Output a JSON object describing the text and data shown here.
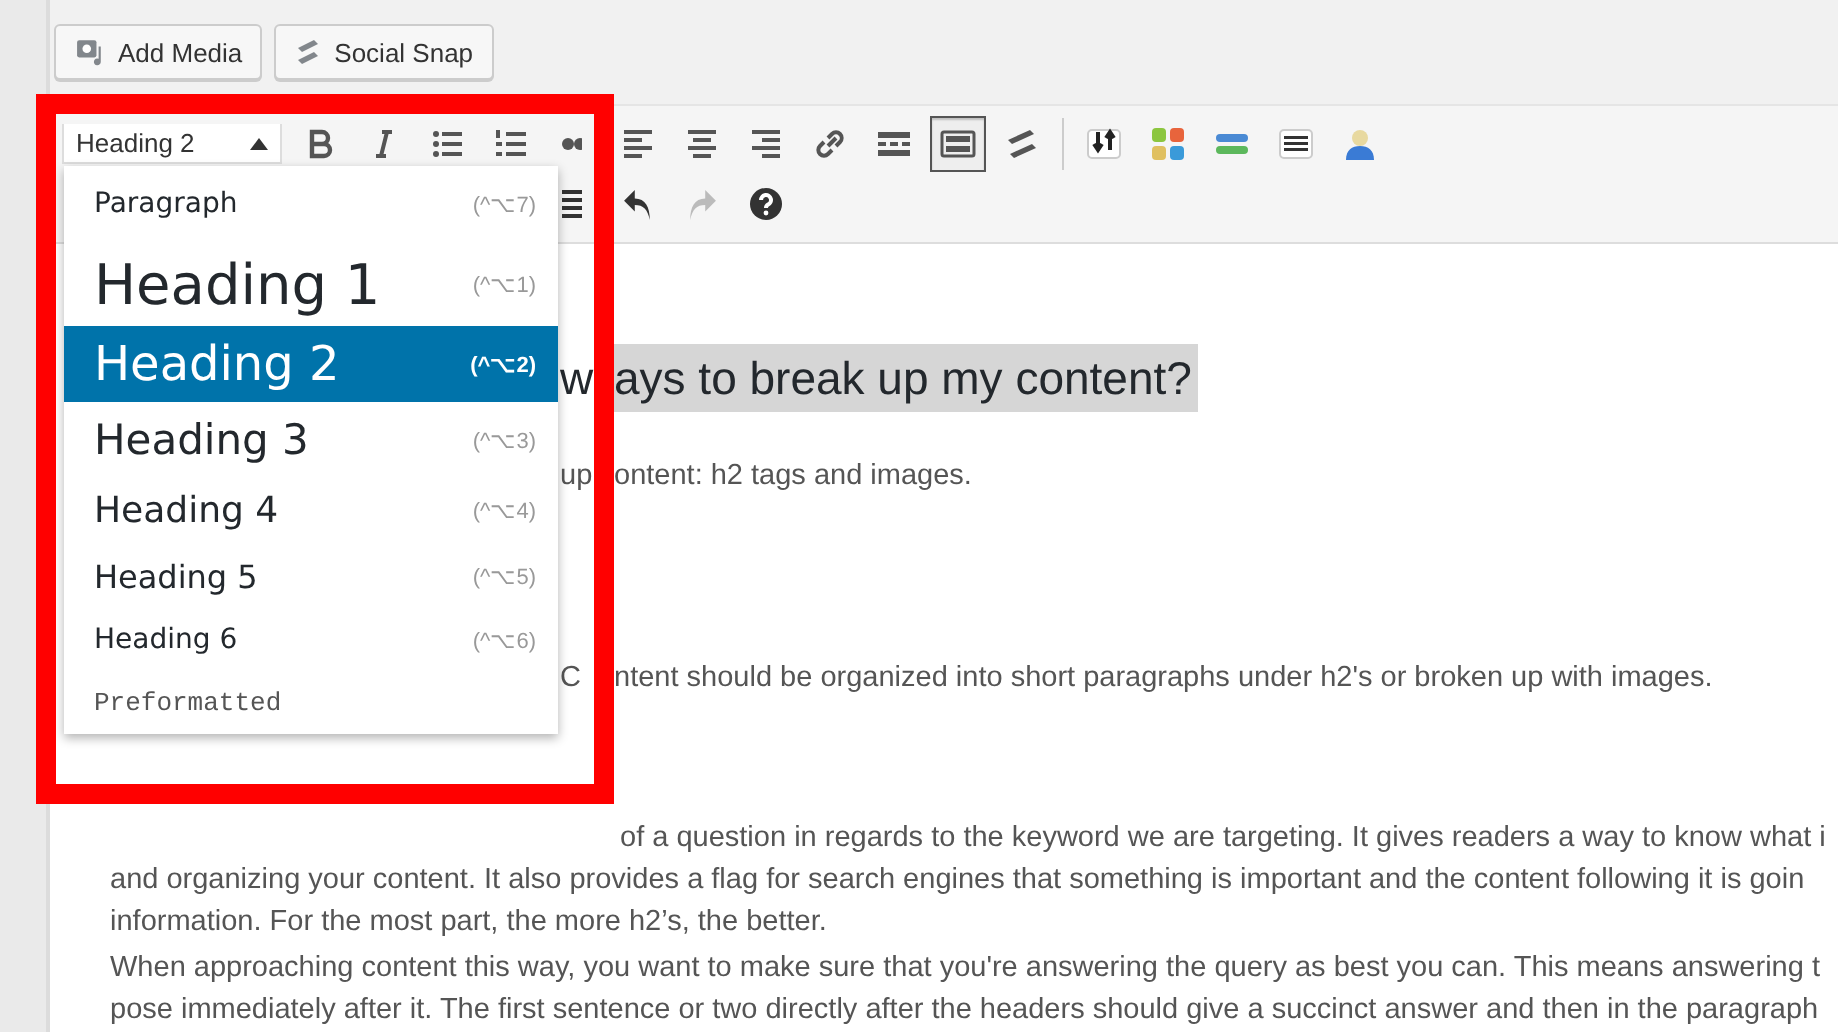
{
  "media_buttons": [
    {
      "kind": "media",
      "label": "Add Media"
    },
    {
      "kind": "snap",
      "label": "Social Snap"
    }
  ],
  "toolbar": {
    "format_select": {
      "value": "Heading 2",
      "expanded": true
    },
    "row1": [
      {
        "kind": "bold",
        "active": false
      },
      {
        "kind": "italic",
        "active": false
      },
      {
        "kind": "bullets",
        "active": false
      },
      {
        "kind": "numbers",
        "active": false
      },
      {
        "kind": "quote",
        "active": false
      },
      {
        "kind": "align-left",
        "active": false
      },
      {
        "kind": "align-center",
        "active": false
      },
      {
        "kind": "align-right",
        "active": false
      },
      {
        "kind": "link",
        "active": false
      },
      {
        "kind": "more",
        "active": false
      },
      {
        "kind": "toggle",
        "active": true
      },
      {
        "kind": "snap",
        "active": false
      },
      {
        "kind": "sort",
        "active": false
      },
      {
        "kind": "blocks",
        "active": false
      },
      {
        "kind": "bars",
        "active": false
      },
      {
        "kind": "list",
        "active": false
      },
      {
        "kind": "person",
        "active": false
      }
    ],
    "row2": [
      {
        "kind": "text-color",
        "disabled": false
      },
      {
        "kind": "undo",
        "disabled": false
      },
      {
        "kind": "redo",
        "disabled": true
      },
      {
        "kind": "help",
        "disabled": false
      }
    ]
  },
  "format_menu": [
    {
      "kind": "paragraph",
      "label": "Paragraph",
      "shortcut": "(^⌥7)",
      "selected": false
    },
    {
      "kind": "h1",
      "label": "Heading 1",
      "shortcut": "(^⌥1)",
      "selected": false
    },
    {
      "kind": "h2",
      "label": "Heading 2",
      "shortcut": "(^⌥2)",
      "selected": true
    },
    {
      "kind": "h3",
      "label": "Heading 3",
      "shortcut": "(^⌥3)",
      "selected": false
    },
    {
      "kind": "h4",
      "label": "Heading 4",
      "shortcut": "(^⌥4)",
      "selected": false
    },
    {
      "kind": "h5",
      "label": "Heading 5",
      "shortcut": "(^⌥5)",
      "selected": false
    },
    {
      "kind": "h6",
      "label": "Heading 6",
      "shortcut": "(^⌥6)",
      "selected": false
    },
    {
      "kind": "pre",
      "label": "Preformatted",
      "selected": false
    }
  ],
  "content": [
    {
      "kind": "heading",
      "lines": [
        {
          "kind": "split",
          "before": "w",
          "text": "ays to break up my content?"
        }
      ]
    },
    {
      "kind": "paragraph",
      "lines": [
        {
          "kind": "split",
          "before": "up",
          "text": "ontent: h2 tags and images."
        }
      ]
    },
    {
      "kind": "paragraph",
      "lines": [
        {
          "kind": "split",
          "before": "C",
          "text": "ntent should be organized into short paragraphs under h2's or broken up with images."
        }
      ]
    },
    {
      "kind": "paragraph",
      "lines": [
        {
          "kind": "after",
          "text": "of a question in regards to the keyword we are targeting. It gives readers a way to know what i"
        },
        {
          "kind": "full",
          "text": "and organizing your content. It also provides a flag for search engines that something is important and the content following it is goin"
        },
        {
          "kind": "full",
          "text": "information. For the most part, the more h2’s, the better."
        }
      ]
    },
    {
      "kind": "paragraph",
      "lines": [
        {
          "kind": "full",
          "text": "When approaching content this way, you want to make sure that you're answering the query as best you can. This means answering t"
        },
        {
          "kind": "full",
          "text": "pose immediately after it. The first sentence or two directly after the headers should give a succinct answer and then in the paragraph"
        }
      ]
    }
  ]
}
